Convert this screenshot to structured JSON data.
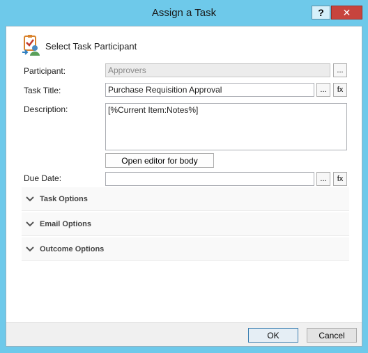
{
  "window": {
    "title": "Assign a Task",
    "help_label": "?",
    "close_label": "✕"
  },
  "header": {
    "title": "Select Task Participant",
    "icon": "task-participant-icon"
  },
  "form": {
    "participant": {
      "label": "Participant:",
      "value": "Approvers",
      "browse_label": "..."
    },
    "task_title": {
      "label": "Task Title:",
      "value": "Purchase Requisition Approval",
      "browse_label": "...",
      "fx_label": "fx"
    },
    "description": {
      "label": "Description:",
      "value": "[%Current Item:Notes%]",
      "editor_label": "Open editor for body"
    },
    "due_date": {
      "label": "Due Date:",
      "value": "",
      "browse_label": "...",
      "fx_label": "fx"
    }
  },
  "sections": [
    {
      "title": "Task Options"
    },
    {
      "title": "Email Options"
    },
    {
      "title": "Outcome Options"
    }
  ],
  "footer": {
    "ok_label": "OK",
    "cancel_label": "Cancel"
  },
  "colors": {
    "titlebar": "#6ec9ea",
    "close_button": "#c7443d"
  }
}
